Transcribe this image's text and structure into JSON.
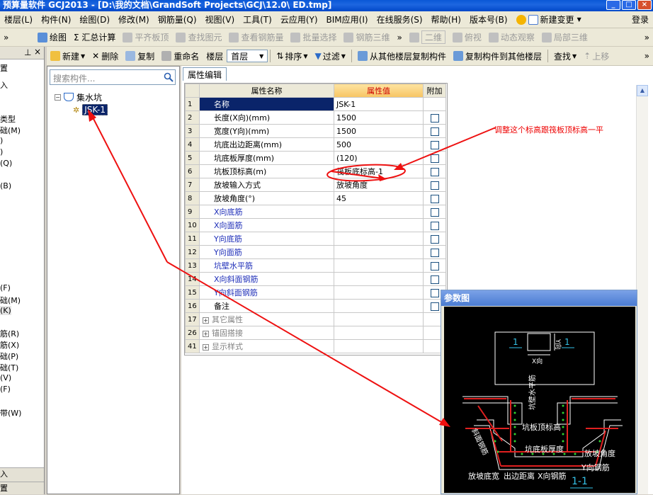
{
  "titlebar": {
    "text": "预算量软件 GCJ2013 - [D:\\我的文档\\GrandSoft Projects\\GCJ\\12.0\\ ED.tmp]",
    "min": "_",
    "max": "□",
    "close": "×"
  },
  "menu": [
    {
      "label": "楼层(L)"
    },
    {
      "label": "构件(N)"
    },
    {
      "label": "绘图(D)"
    },
    {
      "label": "修改(M)"
    },
    {
      "label": "钢筋量(Q)"
    },
    {
      "label": "视图(V)"
    },
    {
      "label": "工具(T)"
    },
    {
      "label": "云应用(Y)"
    },
    {
      "label": "BIM应用(I)"
    },
    {
      "label": "在线服务(S)"
    },
    {
      "label": "帮助(H)"
    },
    {
      "label": "版本号(B)"
    },
    {
      "label": "新建变更"
    },
    {
      "label": "登录"
    }
  ],
  "toolbar1": [
    {
      "label": "绘图",
      "enabled": true
    },
    {
      "label": "Σ 汇总计算",
      "enabled": true
    },
    {
      "label": "平齐板顶",
      "enabled": false
    },
    {
      "label": "查找图元",
      "enabled": false
    },
    {
      "label": "查看钢筋量",
      "enabled": false
    },
    {
      "label": "批量选择",
      "enabled": false
    },
    {
      "label": "钢筋三维",
      "enabled": false
    },
    {
      "label": "二维",
      "enabled": false
    },
    {
      "label": "俯视",
      "enabled": false
    },
    {
      "label": "动态观察",
      "enabled": false
    },
    {
      "label": "局部三维",
      "enabled": false
    }
  ],
  "toolbar2": {
    "new": "新建",
    "delete": "删除",
    "copy": "复制",
    "rename": "重命名",
    "floor_label": "楼层",
    "floor_value": "首层",
    "sort": "排序",
    "filter": "过滤",
    "copy_from": "从其他楼层复制构件",
    "copy_to": "复制构件到其他楼层",
    "find": "查找",
    "up": "上移"
  },
  "left_panel": {
    "items": [
      "置",
      "入",
      "类型",
      "础(M)",
      ")",
      ")",
      "(Q)",
      "(B)",
      "(F)",
      "础(M)",
      "(K)",
      "筋(R)",
      "筋(X)",
      "础(P)",
      "础(T)",
      "(V)",
      "(F)",
      "带(W)",
      "入",
      "置"
    ]
  },
  "components": {
    "search_placeholder": "搜索构件...",
    "tree_root": "集水坑",
    "tree_child": "JSK-1"
  },
  "properties": {
    "tab": "属性编辑",
    "headers": {
      "name": "属性名称",
      "value": "属性值",
      "add": "附加"
    },
    "rows": [
      {
        "num": "1",
        "name": "名称",
        "value": "JSK-1",
        "style": "sel",
        "cb": false
      },
      {
        "num": "2",
        "name": "长度(X向)(mm)",
        "value": "1500",
        "style": "",
        "cb": true
      },
      {
        "num": "3",
        "name": "宽度(Y向)(mm)",
        "value": "1500",
        "style": "",
        "cb": true
      },
      {
        "num": "4",
        "name": "坑底出边距离(mm)",
        "value": "500",
        "style": "",
        "cb": true
      },
      {
        "num": "5",
        "name": "坑底板厚度(mm)",
        "value": "(120)",
        "style": "",
        "cb": true
      },
      {
        "num": "6",
        "name": "坑板顶标高(m)",
        "value": "筏板底标高-1",
        "style": "",
        "cb": true
      },
      {
        "num": "7",
        "name": "放坡输入方式",
        "value": "放坡角度",
        "style": "",
        "cb": true
      },
      {
        "num": "8",
        "name": "放坡角度(°)",
        "value": "45",
        "style": "",
        "cb": true
      },
      {
        "num": "9",
        "name": "X向底筋",
        "value": "",
        "style": "blue",
        "cb": true
      },
      {
        "num": "10",
        "name": "X向面筋",
        "value": "",
        "style": "blue",
        "cb": true
      },
      {
        "num": "11",
        "name": "Y向底筋",
        "value": "",
        "style": "blue",
        "cb": true
      },
      {
        "num": "12",
        "name": "Y向面筋",
        "value": "",
        "style": "blue",
        "cb": true
      },
      {
        "num": "13",
        "name": "坑壁水平筋",
        "value": "",
        "style": "blue",
        "cb": true
      },
      {
        "num": "14",
        "name": "X向斜面钢筋",
        "value": "",
        "style": "blue",
        "cb": true
      },
      {
        "num": "15",
        "name": "Y向斜面钢筋",
        "value": "",
        "style": "blue",
        "cb": true
      },
      {
        "num": "16",
        "name": "备注",
        "value": "",
        "style": "",
        "cb": true
      },
      {
        "num": "17",
        "name": "其它属性",
        "value": "",
        "style": "group",
        "cb": false
      },
      {
        "num": "26",
        "name": "锚固搭接",
        "value": "",
        "style": "group",
        "cb": false
      },
      {
        "num": "41",
        "name": "显示样式",
        "value": "",
        "style": "group",
        "cb": false
      }
    ]
  },
  "annotation": "调整这个标高跟筏板顶标高一平",
  "param_window": {
    "title": "参数图",
    "labels": {
      "one_a": "1",
      "one_b": "1",
      "x_dir": "X向",
      "y_dir": "Y向",
      "wall_h": "坑壁水平筋",
      "top_elev": "坑板顶标高",
      "bottom_thick": "坑底板厚度",
      "slope_angle": "放坡角度",
      "slope_bar": "斜面钢筋",
      "y_bar": "Y向钢筋",
      "slope_width": "放坡底宽",
      "edge_dist": "出边距离",
      "x_bar": "X向钢筋",
      "section": "1-1"
    }
  },
  "colors": {
    "accent_red": "#ee1111",
    "selection": "#0a246a",
    "diagram_cyan": "#35c2e8"
  }
}
